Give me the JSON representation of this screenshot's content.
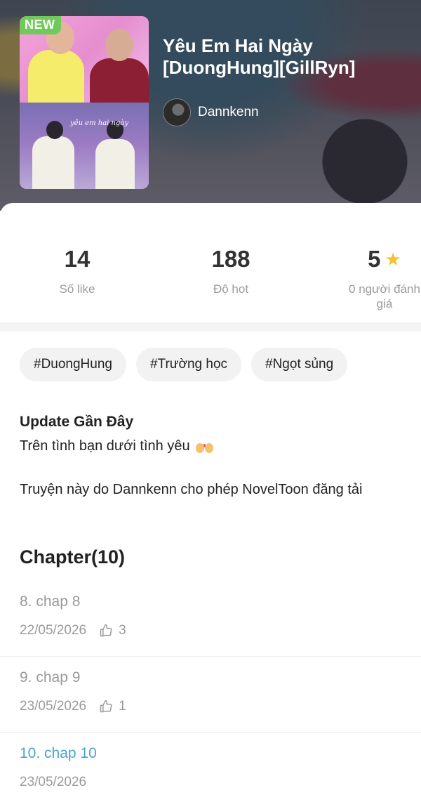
{
  "header": {
    "badge": "NEW",
    "title": "Yêu Em Hai Ngày [DuongHung][GillRyn]",
    "author": "Dannkenn",
    "cover_script": "yêu em hai ngày"
  },
  "stats": [
    {
      "value": "14",
      "label": "Số like"
    },
    {
      "value": "188",
      "label": "Độ hot"
    },
    {
      "value": "5",
      "label": "0 người đánh giá",
      "icon": "star-icon"
    }
  ],
  "tags": [
    "#DuongHung",
    "#Trường học",
    "#Ngọt sủng"
  ],
  "update": {
    "heading": "Update Gần Đây",
    "line1": "Trên tình bạn dưới tình yêu",
    "line2": "Truyện này do Dannkenn cho phép NovelToon đăng tải"
  },
  "chapters": {
    "heading": "Chapter(10)",
    "items": [
      {
        "title": "8. chap 8",
        "date": "22/05/2026",
        "likes": "3"
      },
      {
        "title": "9. chap 9",
        "date": "23/05/2026",
        "likes": "1"
      },
      {
        "title": "10. chap 10",
        "date": "23/05/2026",
        "likes": ""
      }
    ]
  },
  "colors": {
    "badge": "#6fc95b",
    "current_chapter": "#4aa3cf",
    "star": "#f6c12c"
  }
}
